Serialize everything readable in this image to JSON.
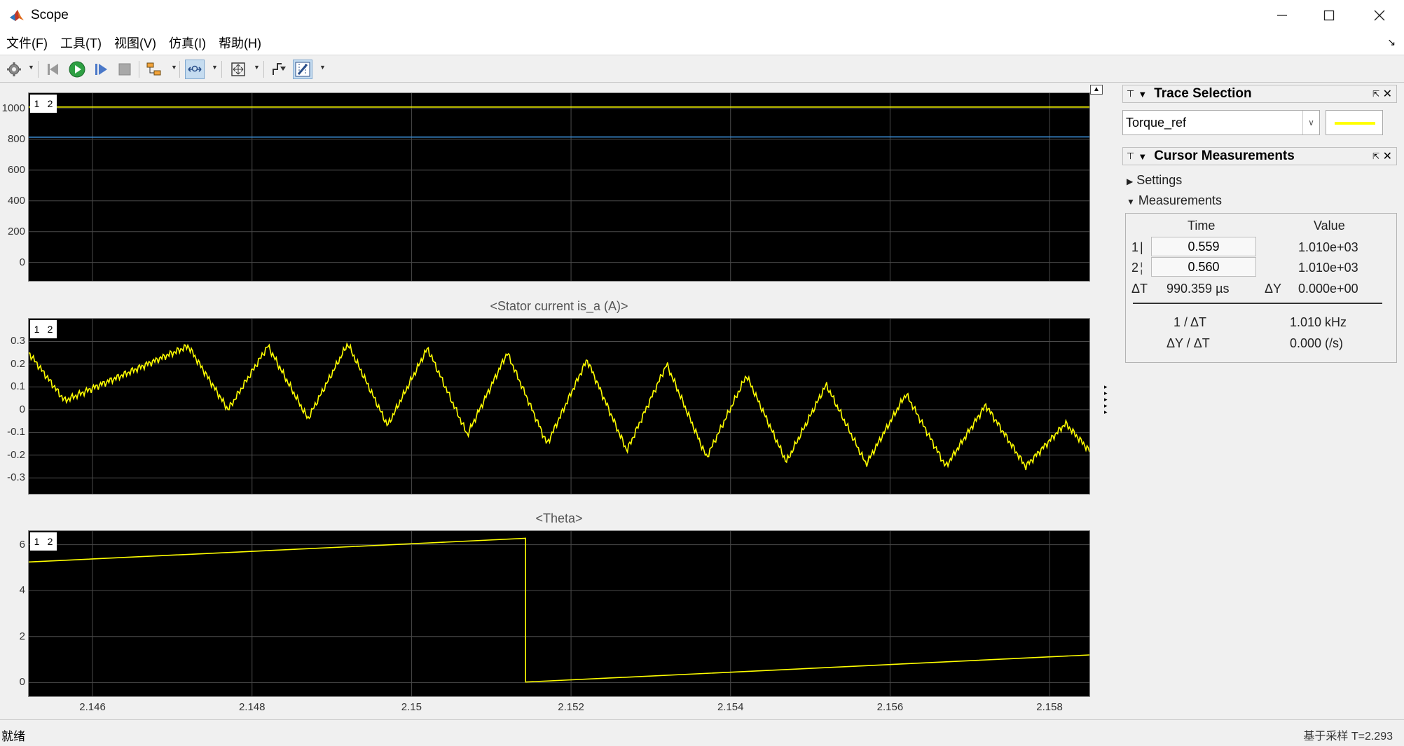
{
  "window": {
    "title": "Scope"
  },
  "menu": [
    "文件(F)",
    "工具(T)",
    "视图(V)",
    "仿真(I)",
    "帮助(H)"
  ],
  "toolbar": {
    "buttons": [
      "settings-icon",
      "step-back-icon",
      "run-icon",
      "step-forward-icon",
      "stop-icon",
      "highlight-block-icon",
      "zoom-icon",
      "autoscale-icon",
      "trigger-icon",
      "cursor-measure-icon"
    ]
  },
  "colors": {
    "trace_yellow": "#ffff00",
    "trace_blue": "#3c8fd8",
    "axes_bg": "#000000",
    "grid": "#4a4a4a"
  },
  "axes": [
    {
      "title": "",
      "legend": [
        "1",
        "2"
      ],
      "yticks": [
        "1000",
        "800",
        "600",
        "400",
        "200",
        "0"
      ]
    },
    {
      "title": "<Stator current is_a (A)>",
      "legend": [
        "1",
        "2"
      ],
      "yticks": [
        "0.3",
        "0.2",
        "0.1",
        "0",
        "-0.1",
        "-0.2",
        "-0.3"
      ]
    },
    {
      "title": "<Theta>",
      "legend": [
        "1",
        "2"
      ],
      "yticks": [
        "6",
        "4",
        "2",
        "0"
      ],
      "xticks": [
        "2.146",
        "2.148",
        "2.15",
        "2.152",
        "2.154",
        "2.156",
        "2.158"
      ]
    }
  ],
  "chart_data": [
    {
      "type": "line",
      "title": "",
      "xlim": [
        2.1452,
        2.1585
      ],
      "ylim": [
        -120,
        1100
      ],
      "series": [
        {
          "name": "Torque_ref",
          "color": "#ffff00",
          "x": [
            2.1452,
            2.1585
          ],
          "y": [
            1010,
            1010
          ]
        },
        {
          "color": "#3c8fd8",
          "x": [
            2.1452,
            2.1585
          ],
          "y": [
            814,
            816
          ]
        }
      ]
    },
    {
      "type": "line",
      "title": "<Stator current is_a (A)>",
      "xlim": [
        2.1452,
        2.1585
      ],
      "ylim": [
        -0.37,
        0.4
      ],
      "series": [
        {
          "color": "#ffff00",
          "x": [
            2.1452,
            2.1457,
            2.1462,
            2.1472,
            2.1482,
            2.1492,
            2.1502,
            2.1512,
            2.1522,
            2.1532,
            2.1542,
            2.1552,
            2.1562,
            2.1572,
            2.1582,
            2.1585
          ],
          "y": [
            0.25,
            0.05,
            0.28,
            0.0,
            0.28,
            -0.04,
            0.29,
            -0.06,
            0.27,
            -0.1,
            0.25,
            -0.15,
            0.22,
            -0.18,
            0.2,
            -0.17
          ],
          "peaks_x": [
            2.1452,
            2.14565,
            2.1472,
            2.1477,
            2.1482,
            2.1487,
            2.1492,
            2.1497,
            2.1502,
            2.1507,
            2.1512,
            2.1517,
            2.1522,
            2.1527,
            2.1532,
            2.1537,
            2.1542,
            2.1547,
            2.1552,
            2.1557,
            2.1562,
            2.1567,
            2.1572,
            2.1577,
            2.1582,
            2.1585
          ],
          "peaks_y": [
            0.25,
            0.04,
            0.28,
            0.0,
            0.28,
            -0.04,
            0.29,
            -0.07,
            0.27,
            -0.11,
            0.25,
            -0.15,
            0.22,
            -0.18,
            0.2,
            -0.21,
            0.15,
            -0.23,
            0.11,
            -0.24,
            0.07,
            -0.25,
            0.02,
            -0.25,
            -0.06,
            -0.18
          ]
        }
      ]
    },
    {
      "type": "line",
      "title": "<Theta>",
      "xlim": [
        2.1452,
        2.1585
      ],
      "ylim": [
        -0.6,
        6.6
      ],
      "series": [
        {
          "color": "#ffff00",
          "x": [
            2.1452,
            2.15143,
            2.15143,
            2.1585
          ],
          "y": [
            5.25,
            6.28,
            0.02,
            1.2
          ]
        }
      ]
    }
  ],
  "trace_selection": {
    "title": "Trace Selection",
    "selected": "Torque_ref"
  },
  "cursor_measurements": {
    "title": "Cursor Measurements",
    "settings_label": "Settings",
    "measurements_label": "Measurements",
    "col_time": "Time",
    "col_value": "Value",
    "row1": {
      "idx": "1",
      "time": "0.559",
      "value": "1.010e+03"
    },
    "row2": {
      "idx": "2",
      "time": "0.560",
      "value": "1.010e+03"
    },
    "dt_label": "ΔT",
    "dt_value": "990.359 µs",
    "dy_label": "ΔY",
    "dy_value": "0.000e+00",
    "inv_dt_label": "1 / ΔT",
    "inv_dt_value": "1.010 kHz",
    "slope_label": "ΔY / ΔT",
    "slope_value": "0.000 (/s)"
  },
  "status": {
    "left": "就绪",
    "right": "基于采样  T=2.293"
  }
}
